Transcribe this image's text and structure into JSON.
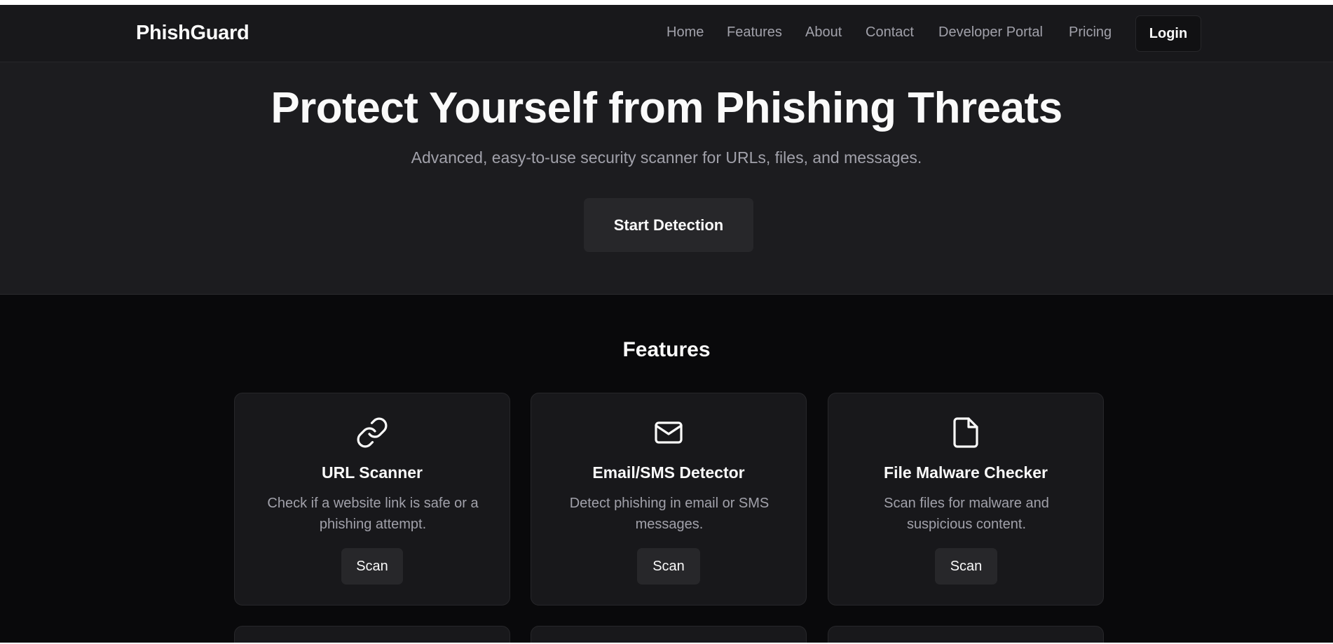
{
  "navbar": {
    "brand": "PhishGuard",
    "links": [
      "Home",
      "Features",
      "About",
      "Contact",
      "Developer Portal",
      "Pricing"
    ],
    "login_label": "Login"
  },
  "hero": {
    "title": "Protect Yourself from Phishing Threats",
    "subtitle": "Advanced, easy-to-use security scanner for URLs, files, and messages.",
    "cta_label": "Start Detection"
  },
  "features": {
    "heading": "Features",
    "cards": [
      {
        "icon": "link-icon",
        "title": "URL Scanner",
        "description": "Check if a website link is safe or a phishing attempt.",
        "button": "Scan"
      },
      {
        "icon": "mail-icon",
        "title": "Email/SMS Detector",
        "description": "Detect phishing in email or SMS messages.",
        "button": "Scan"
      },
      {
        "icon": "file-icon",
        "title": "File Malware Checker",
        "description": "Scan files for malware and suspicious content.",
        "button": "Scan"
      }
    ]
  },
  "colors": {
    "page_bg": "#09090b",
    "header_bg": "#18181b",
    "hero_bg": "#1c1c1f",
    "card_bg": "#18181b",
    "button_bg": "#27272a",
    "text_primary": "#fafafa",
    "text_muted": "#a1a1aa"
  }
}
